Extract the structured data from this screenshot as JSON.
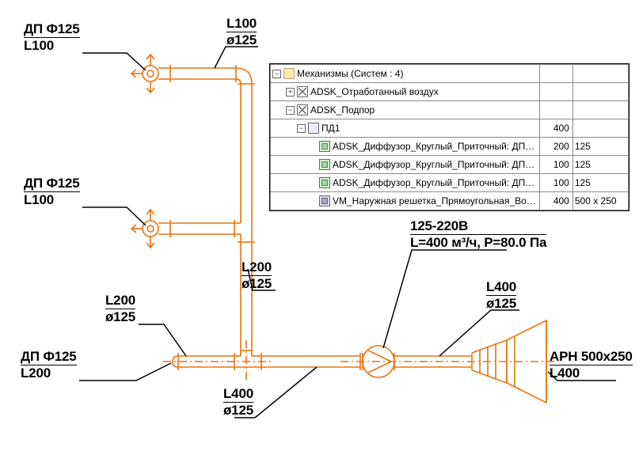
{
  "labels": {
    "dp_top": {
      "line1": "ДП Ф125",
      "line2": "L100"
    },
    "seg_l100": {
      "line1": "L100",
      "line2": "ø125"
    },
    "dp_mid": {
      "line1": "ДП Ф125",
      "line2": "L100"
    },
    "seg_l200v": {
      "line1": "L200",
      "line2": "ø125"
    },
    "seg_l200h": {
      "line1": "L200",
      "line2": "ø125"
    },
    "dp_bot": {
      "line1": "ДП Ф125",
      "line2": "L200"
    },
    "seg_l400b": {
      "line1": "L400",
      "line2": "ø125"
    },
    "fan": {
      "line1": "125-220В",
      "line2": "L=400 м³/ч, Р=80.0 Па"
    },
    "seg_l400r": {
      "line1": "L400",
      "line2": "ø125"
    },
    "grille": {
      "line1": "АРН 500х250",
      "line2": "L400"
    }
  },
  "panel": {
    "header": "Механизмы (Систем : 4)",
    "row_sys1": "ADSK_Отработанный воздух",
    "row_sys2": "ADSK_Подпор",
    "row_node": "ПД1",
    "row_node_val": "400",
    "rows": [
      {
        "name": "ADSK_Диффузор_Круглый_Приточный: ДП…",
        "v1": "200",
        "v2": "125"
      },
      {
        "name": "ADSK_Диффузор_Круглый_Приточный: ДП…",
        "v1": "100",
        "v2": "125"
      },
      {
        "name": "ADSK_Диффузор_Круглый_Приточный: ДП…",
        "v1": "100",
        "v2": "125"
      },
      {
        "name": "VM_Наружная решетка_Прямоугольная_Во…",
        "v1": "400",
        "v2": "500 x 250"
      }
    ]
  },
  "colors": {
    "duct": "#e8730f",
    "leader": "#000000"
  }
}
